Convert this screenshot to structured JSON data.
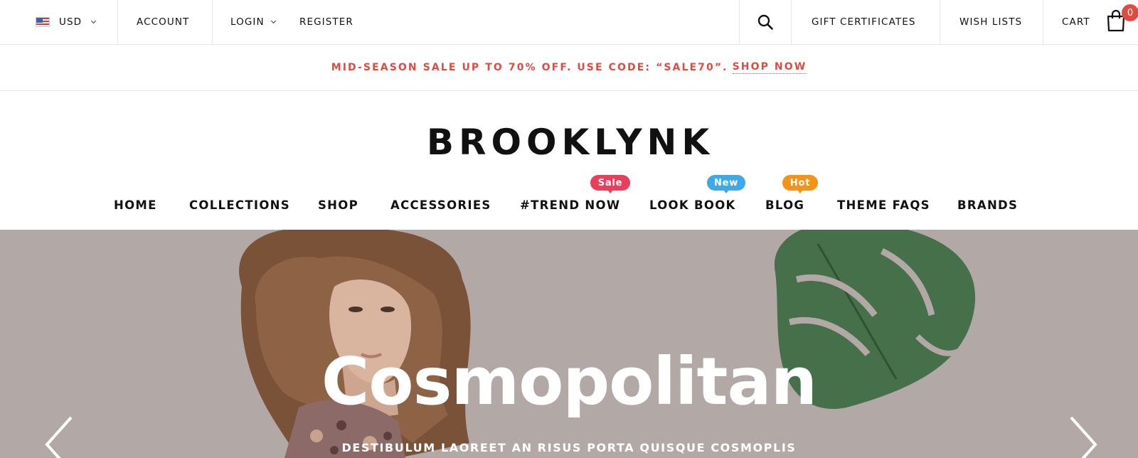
{
  "topbar": {
    "currency": "USD",
    "account": "ACCOUNT",
    "login": "LOGIN",
    "register": "REGISTER",
    "gift_certificates": "GIFT CERTIFICATES",
    "wish_lists": "WISH LISTS",
    "cart": "CART",
    "cart_count": "0"
  },
  "promo": {
    "text": "MID-SEASON SALE UP TO 70% OFF. USE CODE: “SALE70”.",
    "link": "SHOP NOW"
  },
  "logo": {
    "text": "BROOKLYNK"
  },
  "nav": {
    "items": [
      "HOME",
      "COLLECTIONS",
      "SHOP",
      "ACCESSORIES",
      "#TREND NOW",
      "LOOK BOOK",
      "BLOG",
      "THEME FAQS",
      "BRANDS"
    ],
    "badges": {
      "sale": "Sale",
      "new": "New",
      "hot": "Hot"
    }
  },
  "hero": {
    "title": "Cosmopolitan",
    "subtitle": "DESTIBULUM LAOREET AN RISUS PORTA QUISQUE COSMOPLIS"
  },
  "colors": {
    "accent_red": "#e04b3f",
    "sale_badge": "#e8405c",
    "new_badge": "#3fa9e8",
    "hot_badge": "#f39318",
    "hero_bg": "#b2a8a6"
  }
}
